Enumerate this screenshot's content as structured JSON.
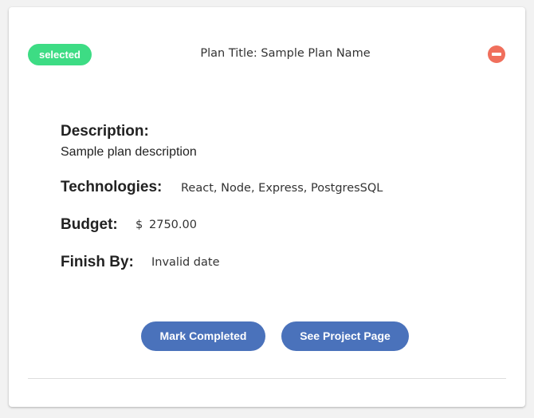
{
  "card": {
    "status_badge": "selected",
    "plan_title": "Plan Title: Sample Plan Name",
    "remove_icon": "minus-circle-icon"
  },
  "details": {
    "description_label": "Description:",
    "description_value": "Sample plan description",
    "technologies_label": "Technologies:",
    "technologies_value": "React, Node, Express, PostgresSQL",
    "budget_label": "Budget:",
    "budget_currency": "$",
    "budget_value": "2750.00",
    "finish_label": "Finish By:",
    "finish_value": "Invalid date"
  },
  "actions": {
    "mark_completed": "Mark Completed",
    "see_project_page": "See Project Page"
  },
  "colors": {
    "badge": "#3ddc84",
    "remove": "#f06f5c",
    "button": "#4a72bb"
  }
}
